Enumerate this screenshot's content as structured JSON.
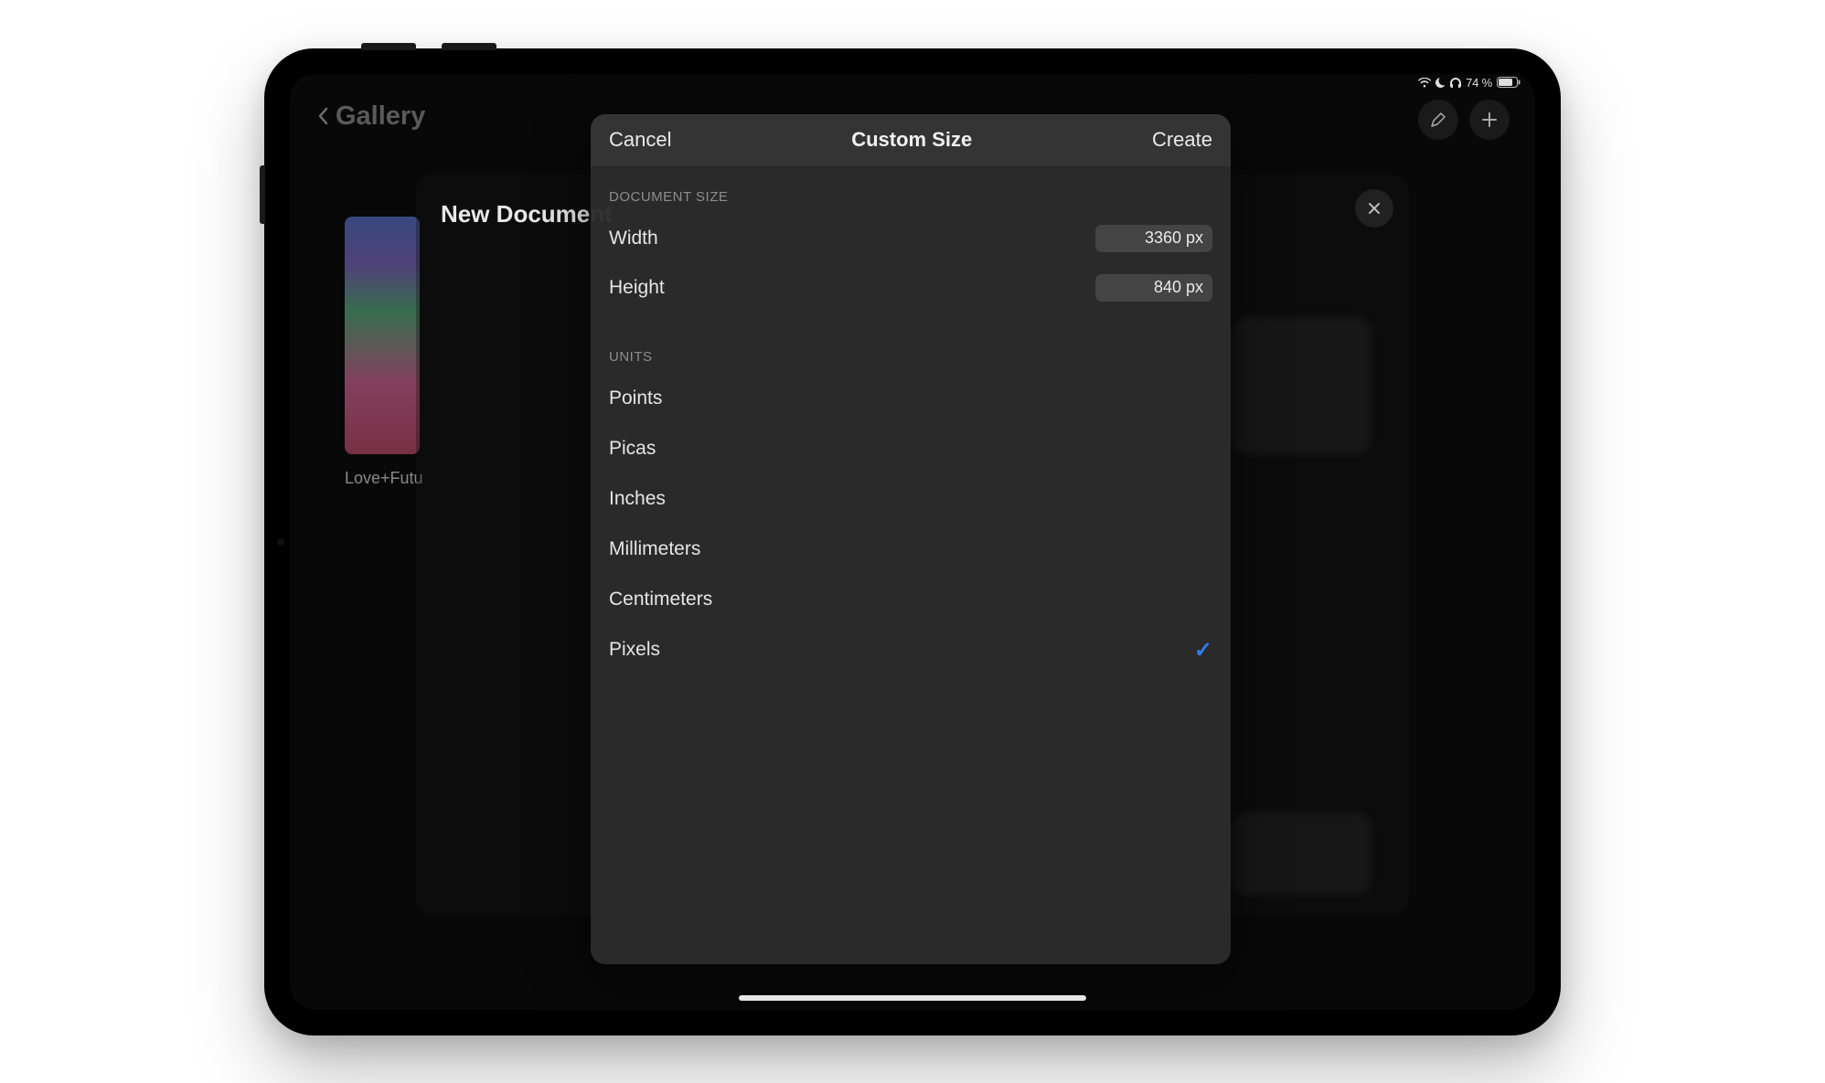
{
  "status": {
    "battery_text": "74 %"
  },
  "topbar": {
    "gallery": "Gallery"
  },
  "thumb": {
    "label": "Love+Futu"
  },
  "sheet": {
    "title": "New Document"
  },
  "modal": {
    "cancel": "Cancel",
    "title": "Custom Size",
    "create": "Create",
    "section_size": "Document Size",
    "width_label": "Width",
    "width_value": "3360 px",
    "height_label": "Height",
    "height_value": "840 px",
    "section_units": "Units",
    "units": {
      "points": "Points",
      "picas": "Picas",
      "inches": "Inches",
      "millimeters": "Millimeters",
      "centimeters": "Centimeters",
      "pixels": "Pixels"
    },
    "selected_unit": "pixels"
  }
}
